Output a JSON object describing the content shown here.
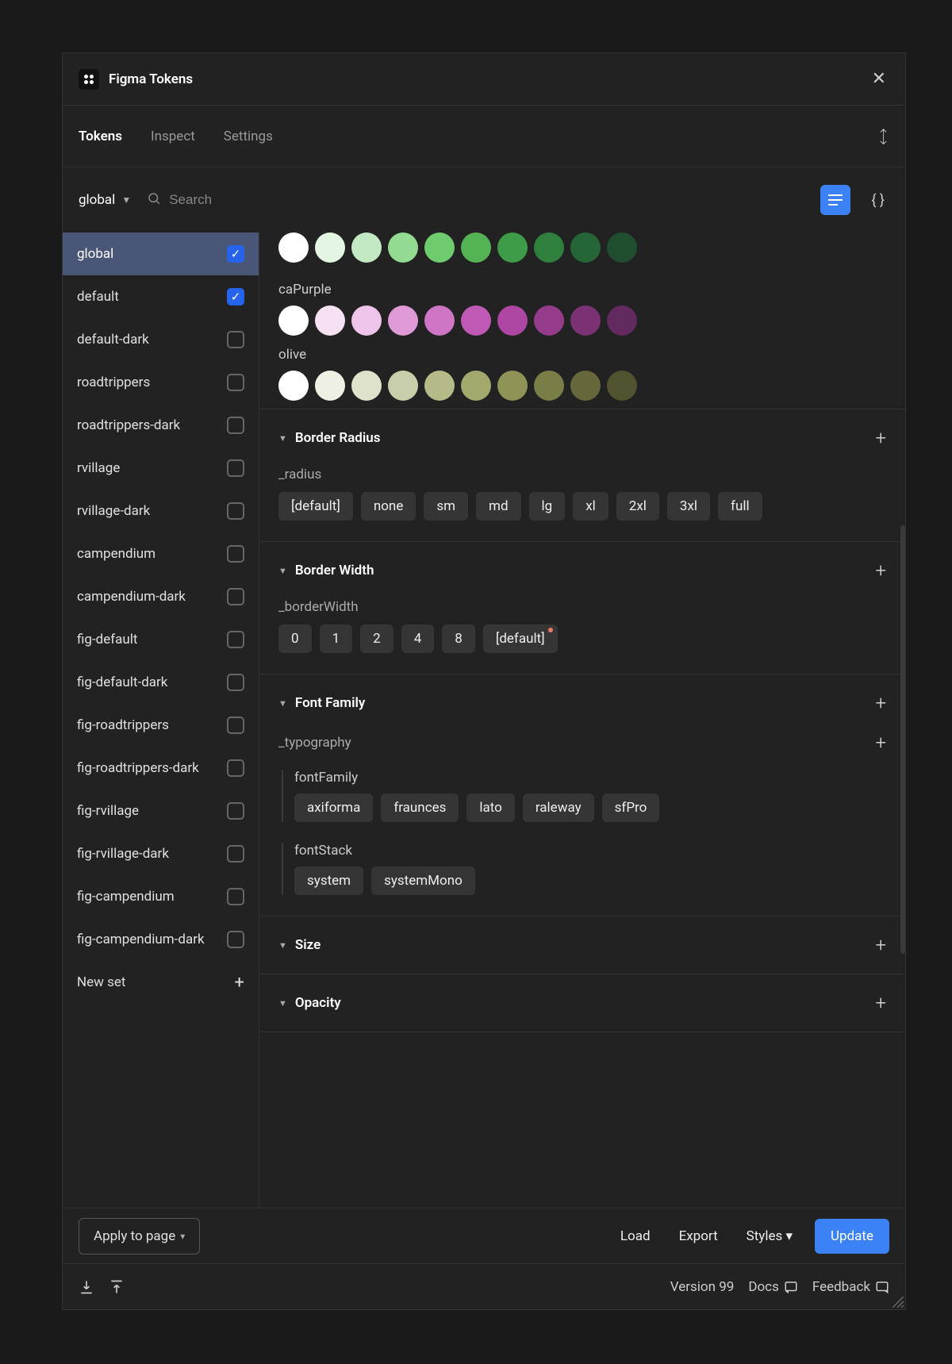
{
  "title": "Figma Tokens",
  "tabs": [
    "Tokens",
    "Inspect",
    "Settings"
  ],
  "activeTab": 0,
  "selectedSet": "global",
  "searchPlaceholder": "Search",
  "sets": [
    {
      "name": "global",
      "checked": true,
      "selected": true
    },
    {
      "name": "default",
      "checked": true
    },
    {
      "name": "default-dark",
      "checked": false
    },
    {
      "name": "roadtrippers",
      "checked": false
    },
    {
      "name": "roadtrippers-dark",
      "checked": false
    },
    {
      "name": "rvillage",
      "checked": false
    },
    {
      "name": "rvillage-dark",
      "checked": false
    },
    {
      "name": "campendium",
      "checked": false
    },
    {
      "name": "campendium-dark",
      "checked": false
    },
    {
      "name": "fig-default",
      "checked": false
    },
    {
      "name": "fig-default-dark",
      "checked": false
    },
    {
      "name": "fig-roadtrippers",
      "checked": false
    },
    {
      "name": "fig-roadtrippers-dark",
      "checked": false
    },
    {
      "name": "fig-rvillage",
      "checked": false
    },
    {
      "name": "fig-rvillage-dark",
      "checked": false
    },
    {
      "name": "fig-campendium",
      "checked": false
    },
    {
      "name": "fig-campendium-dark",
      "checked": false
    }
  ],
  "newSetLabel": "New set",
  "colorGroups": {
    "partialGreen": [
      "#ffffff",
      "#e4f5e4",
      "#c3e9c3",
      "#93db93",
      "#6ecb6e",
      "#54b354",
      "#3e9b48",
      "#2f7f3d",
      "#256636",
      "#1f4e2f"
    ],
    "caPurple": {
      "label": "caPurple",
      "colors": [
        "#ffffff",
        "#f6e1f3",
        "#efc4ea",
        "#df9ad7",
        "#cf75c6",
        "#c059b6",
        "#ad47a3",
        "#953b8c",
        "#7b3274",
        "#622a5e"
      ]
    },
    "olive": {
      "label": "olive",
      "colors": [
        "#ffffff",
        "#eef0e3",
        "#dfe2cb",
        "#c9ceaa",
        "#b5ba88",
        "#a3a86d",
        "#8f9355",
        "#7a7d46",
        "#66683b",
        "#505230"
      ]
    }
  },
  "sections": {
    "borderRadius": {
      "title": "Border Radius",
      "sub": "_radius",
      "chips": [
        "[default]",
        "none",
        "sm",
        "md",
        "lg",
        "xl",
        "2xl",
        "3xl",
        "full"
      ]
    },
    "borderWidth": {
      "title": "Border Width",
      "sub": "_borderWidth",
      "chips": [
        "0",
        "1",
        "2",
        "4",
        "8",
        "[default]"
      ],
      "flagged": 5
    },
    "fontFamily": {
      "title": "Font Family",
      "sub": "_typography",
      "fontFamily": {
        "label": "fontFamily",
        "chips": [
          "axiforma",
          "fraunces",
          "lato",
          "raleway",
          "sfPro"
        ]
      },
      "fontStack": {
        "label": "fontStack",
        "chips": [
          "system",
          "systemMono"
        ]
      }
    },
    "size": {
      "title": "Size"
    },
    "opacity": {
      "title": "Opacity"
    }
  },
  "footer": {
    "apply": "Apply to page",
    "load": "Load",
    "export": "Export",
    "styles_label": "Styles",
    "update": "Update",
    "version": "Version 99",
    "docs": "Docs",
    "feedback": "Feedback"
  }
}
